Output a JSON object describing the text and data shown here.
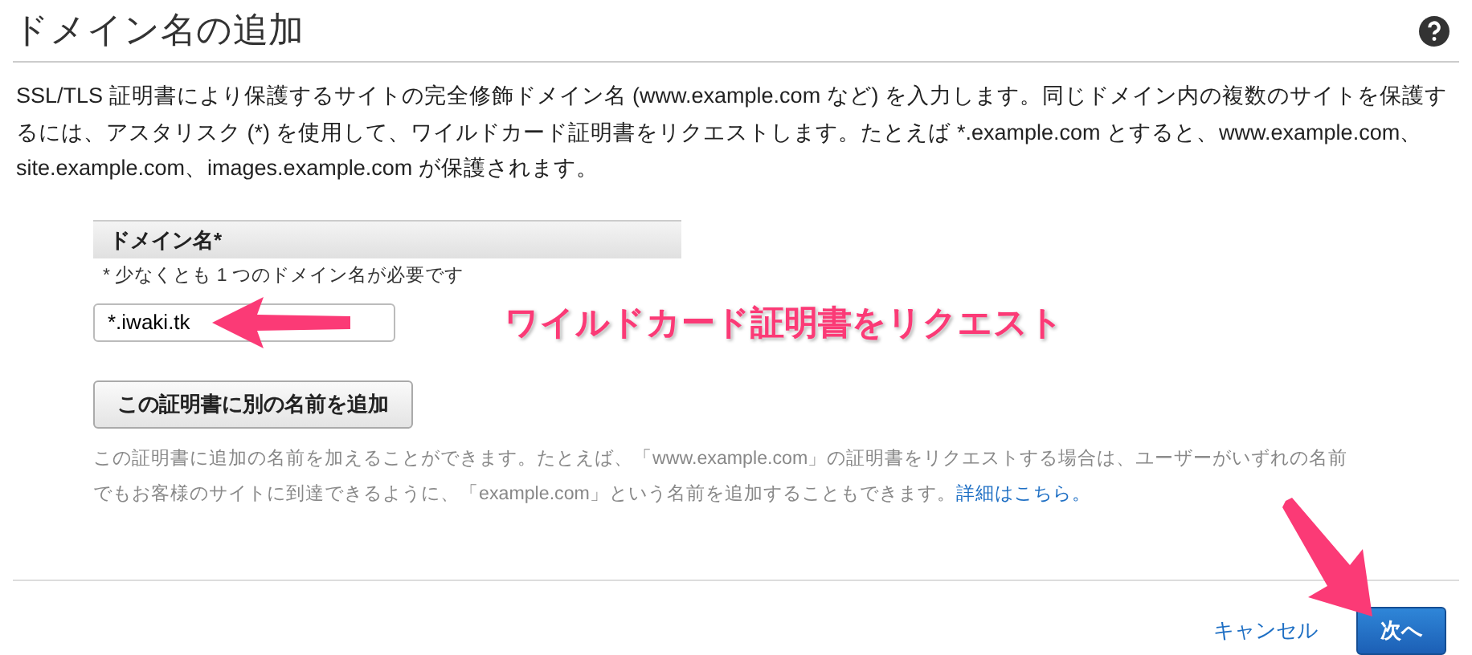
{
  "title": "ドメイン名の追加",
  "description": "SSL/TLS 証明書により保護するサイトの完全修飾ドメイン名 (www.example.com など) を入力します。同じドメイン内の複数のサイトを保護するには、アスタリスク (*) を使用して、ワイルドカード証明書をリクエストします。たとえば *.example.com とすると、www.example.com、site.example.com、images.example.com が保護されます。",
  "domain_section": {
    "header": "ドメイン名*",
    "hint": "* 少なくとも 1 つのドメイン名が必要です",
    "value": "*.iwaki.tk"
  },
  "annotation": "ワイルドカード証明書をリクエスト",
  "add_name_button": "この証明書に別の名前を追加",
  "help_text": "この証明書に追加の名前を加えることができます。たとえば、「www.example.com」の証明書をリクエストする場合は、ユーザーがいずれの名前でもお客様のサイトに到達できるように、「example.com」という名前を追加することもできます。",
  "help_link": "詳細はこちら。",
  "buttons": [
    {
      "label": "キャンセル",
      "kind": "link"
    },
    {
      "label": "次へ",
      "kind": "primary"
    }
  ]
}
